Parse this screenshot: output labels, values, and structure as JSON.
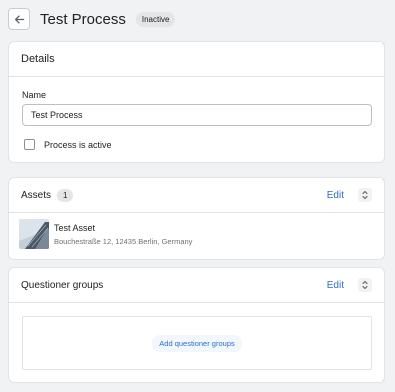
{
  "header": {
    "title": "Test Process",
    "status": "Inactive",
    "back_icon": "arrow-left-icon"
  },
  "details": {
    "title": "Details",
    "name_label": "Name",
    "name_value": "Test Process",
    "active_label": "Process is active",
    "active_checked": false
  },
  "assets": {
    "title": "Assets",
    "count": "1",
    "edit_label": "Edit",
    "items": [
      {
        "name": "Test Asset",
        "address": "Bouchestraße 12, 12435 Berlin, Germany",
        "thumbnail_icon": "building-photo"
      }
    ]
  },
  "groups": {
    "title": "Questioner groups",
    "edit_label": "Edit",
    "add_label": "Add questioner groups"
  },
  "colors": {
    "accent": "#2c6ecb",
    "background": "#f1f2f3",
    "border": "#e1e3e5"
  }
}
